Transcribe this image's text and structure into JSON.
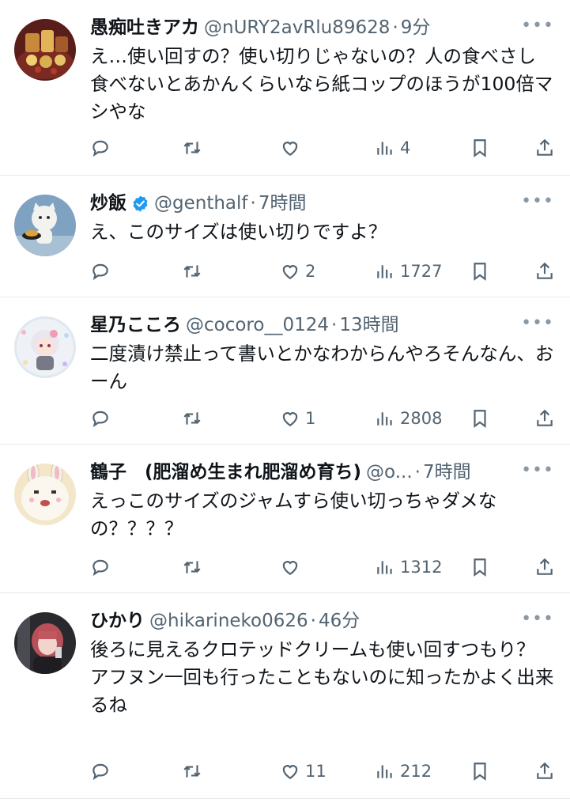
{
  "tweets": [
    {
      "name": "愚痴吐きアカ",
      "handle": "@nURY2avRlu89628",
      "time": "9分",
      "text": "え…使い回すの？使い切りじゃないの？人の食べさし食べないとあかんくらいなら紙コップのほうが100倍マシやな",
      "likes": "",
      "views": "4",
      "verified": false,
      "avatar_icon": "food-photo-avatar"
    },
    {
      "name": "炒飯",
      "handle": "@genthalf",
      "time": "7時間",
      "text": "え、このサイズは使い切りですよ？",
      "likes": "2",
      "views": "1727",
      "verified": true,
      "avatar_icon": "cat-figure-avatar"
    },
    {
      "name": "星乃こころ",
      "handle": "@cocoro__0124",
      "time": "13時間",
      "text": "二度漬け禁止って書いとかなわからんやろそんなん、おーん",
      "likes": "1",
      "views": "2808",
      "verified": false,
      "avatar_icon": "anime-girl-avatar"
    },
    {
      "name": "鶴子　(肥溜め生まれ肥溜め育ち)",
      "handle": "@o...",
      "time": "7時間",
      "text": "えっこのサイズのジャムすら使い切っちゃダメなの？？？？",
      "likes": "",
      "views": "1312",
      "verified": false,
      "avatar_icon": "mascot-face-avatar"
    },
    {
      "name": "ひかり",
      "handle": "@hikarineko0626",
      "time": "46分",
      "text": "後ろに見えるクロテッドクリームも使い回すつもり？\nアフヌン一回も行ったこともないのに知ったかよく出来るね",
      "likes": "11",
      "views": "212",
      "verified": false,
      "avatar_icon": "person-photo-avatar"
    }
  ],
  "sep": "·",
  "more_label": "•••",
  "colors": {
    "text": "#0f1419",
    "secondary": "#536471",
    "verified": "#1d9bf0",
    "divider": "#e6e9ec"
  }
}
